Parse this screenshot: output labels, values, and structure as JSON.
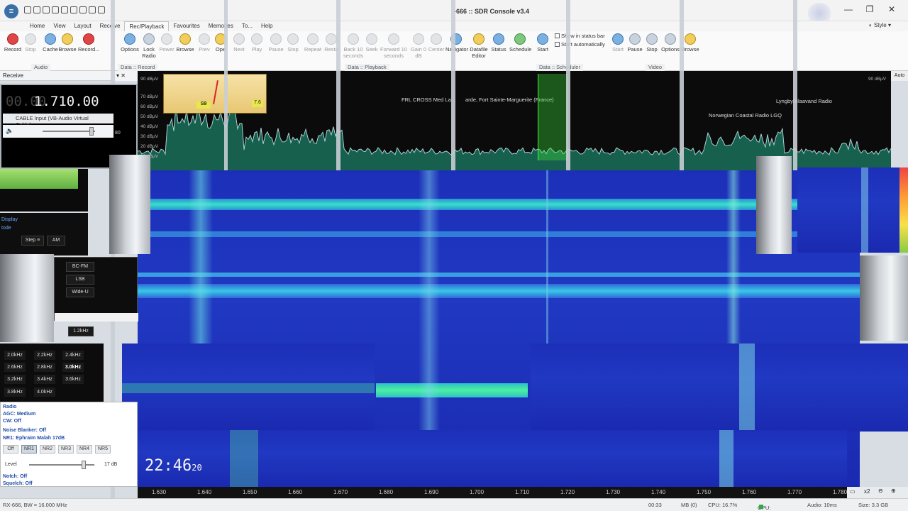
{
  "window": {
    "title": "-666 :: SDR Console v3.4",
    "minimize": "—",
    "maximize": "❐",
    "close": "✕"
  },
  "ribbon_tabs": [
    "Home",
    "View",
    "Layout",
    "Receive",
    "Rec/Playback",
    "Favourites",
    "Memories",
    "To...",
    "Help"
  ],
  "active_tab": "Rec/Playback",
  "style_label": "Style",
  "ribbon": {
    "record": "Record",
    "stop": "Stop",
    "cache": "Cache",
    "browse": "Browse",
    "record2": "Record...",
    "options": "Options",
    "lock_radio": "Lock Radio",
    "power": "Power",
    "browse2": "Browse",
    "prev": "Prev",
    "open": "Ope",
    "next": "Next",
    "play": "Play",
    "pause": "Pause",
    "stop2": "Stop",
    "repeat": "Repeat",
    "restart": "Resta",
    "back10": "Back 10 seconds",
    "seek": "Seek",
    "forward10": "Forward 10 seconds",
    "gain": "Gain 0 dB",
    "center": "Center",
    "navigator": "Navigator",
    "datafile_editor": "Datafile Editor",
    "status": "Status",
    "schedule": "Schedule",
    "start": "Start",
    "show_status_bar": "Show in status bar",
    "start_auto": "Start automatically",
    "start2": "Start",
    "pause2": "Pause",
    "stop3": "Stop",
    "options2": "Options",
    "browse3": "Browse"
  },
  "groups": {
    "receive": "Receive",
    "audio": "Audio",
    "data_record": "Data :: Record",
    "data_playback": "Data :: Playback",
    "data_scheduler": "Data :: Scheduler",
    "video": "Video"
  },
  "spectrum": {
    "dbv_top": "90 dBµV",
    "dbv_labels": [
      "70 dBµV",
      "60 dBµV",
      "50 dBµV",
      "40 dBµV",
      "30 dBµV",
      "20 dBµV",
      "10 dBµV"
    ],
    "auto_label": "Auto",
    "smeter_s": "S9",
    "smeter_val": "7.6",
    "station_1": "FRL CROSS Med La...",
    "station_2": "arde, Fort Sainte-Marguerite (France)",
    "station_3": "Norwegian Coastal Radio LGQ",
    "station_4": "Lyngby/Blaavand Radio"
  },
  "radio": {
    "freq_dim": "00.00",
    "freq_val": "1.710.00",
    "audio_input": "CABLE Input (VB-Audio Virtual Cable)",
    "volume_num": "80",
    "display_label": "Display",
    "mode_label": "tode"
  },
  "modes": [
    "BC-FM",
    "LSB",
    "Wide-U"
  ],
  "mode_extra": [
    "Step ≡",
    "AM"
  ],
  "bandwidths": [
    "2.0kHz",
    "2.2kHz",
    "2.4kHz",
    "2.6kHz",
    "2.8kHz",
    "3.0kHz",
    "3.2kHz",
    "3.4kHz",
    "3.6kHz",
    "3.8kHz",
    "4.0kHz"
  ],
  "bw_selected": "3.0kHz",
  "bw_extra": "1.2kHz",
  "dsp": {
    "radio": "Radio",
    "agc": "AGC: Medium",
    "cw": "CW: Off",
    "noise_blanker": "Noise Blanker: Off",
    "nr1": "NR1: Ephraim Malah 17dB",
    "level_label": "Level",
    "level_val": "17 dB",
    "notch": "Notch: Off",
    "squelch": "Squelch: Off"
  },
  "nr_buttons": [
    "Off",
    "NR1",
    "NR2",
    "NR3",
    "NR4",
    "NR5"
  ],
  "nr_selected": "NR1",
  "clock": {
    "hm": "22:46",
    "sec": "20"
  },
  "axis": [
    "1.630",
    "1.640",
    "1.650",
    "1.660",
    "1.670",
    "1.680",
    "1.690",
    "1.700",
    "1.710",
    "1.720",
    "1.730",
    "1.740",
    "1.750",
    "1.760",
    "1.770",
    "1.780"
  ],
  "zoom": "x2",
  "statusbar": {
    "left": "RX-666, BW = 16.000 MHz",
    "time": "00:33",
    "mem": "MB (0)",
    "cpu": "CPU: 16.7%",
    "gpu": "GPU: 36.8%",
    "audio": "Audio: 10ms",
    "size": "Size: 3.3 GB"
  },
  "colors": {
    "waterfall_base": "#1f34bd",
    "signal": "#39e0c8",
    "accent_green": "#2faa4a"
  }
}
